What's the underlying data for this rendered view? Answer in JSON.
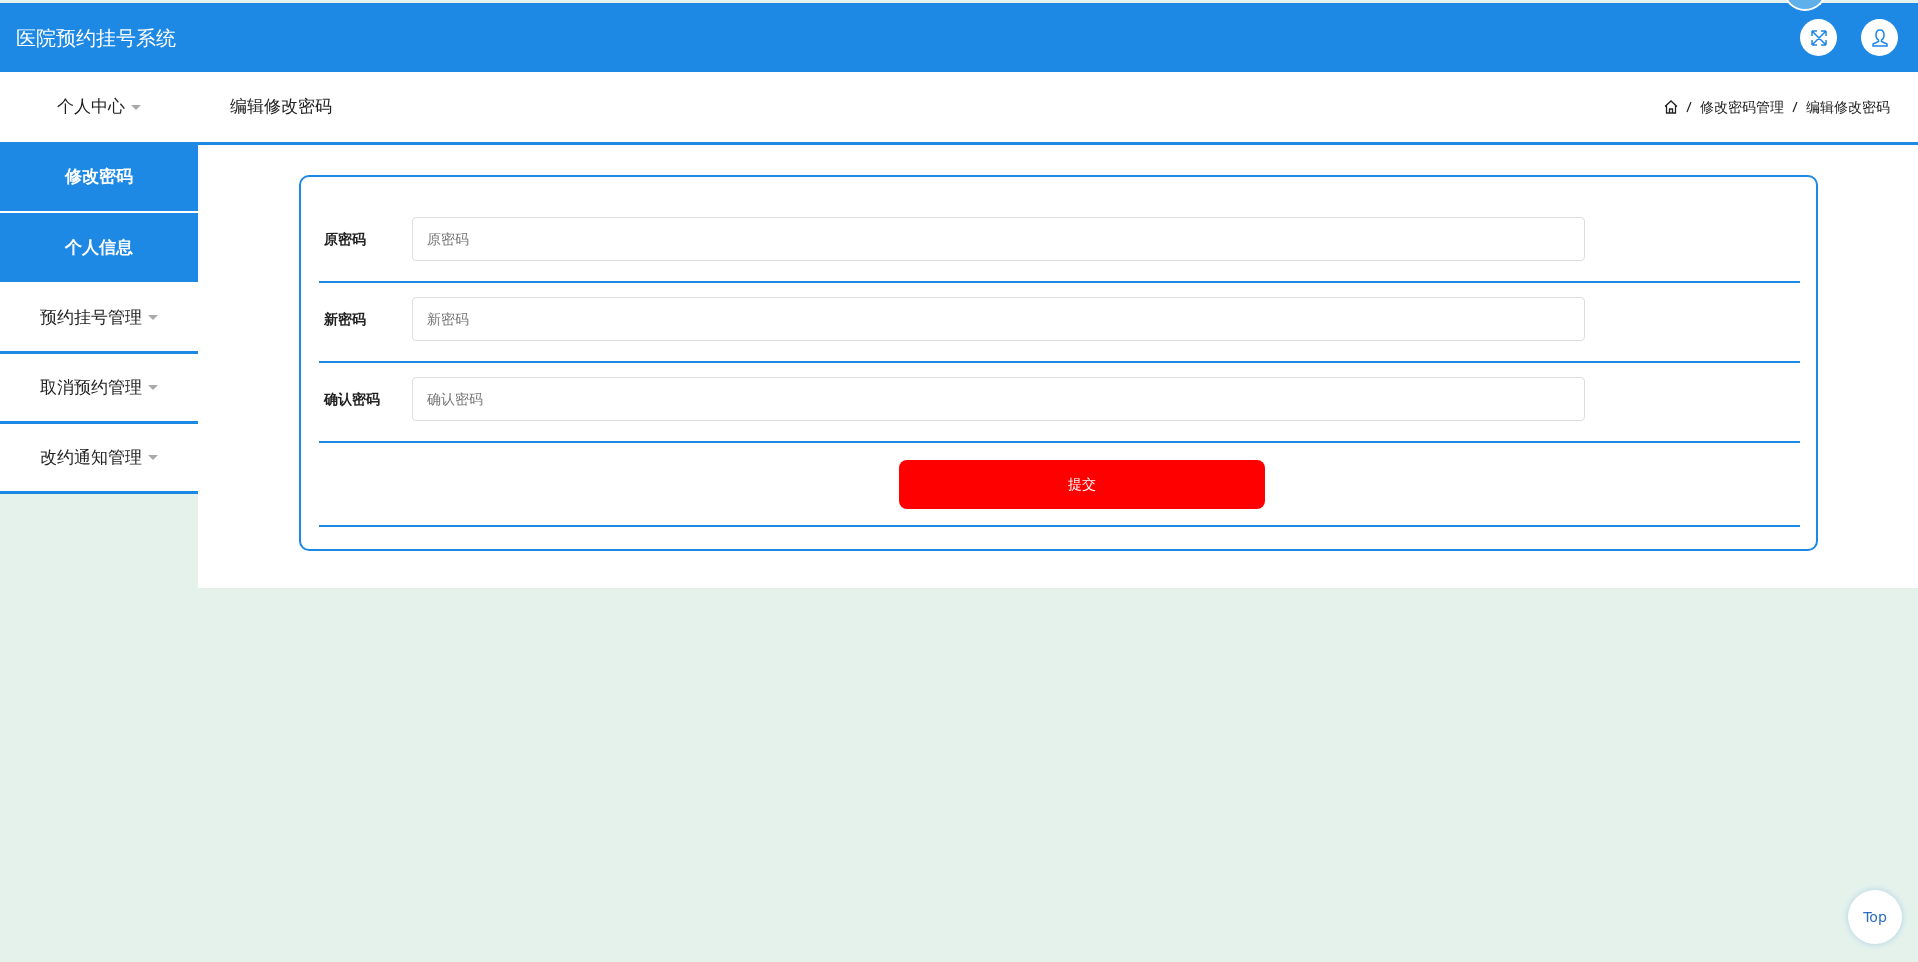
{
  "header": {
    "title": "医院预约挂号系统"
  },
  "sidebar": {
    "items": [
      {
        "label": "个人中心",
        "expanded": true,
        "children": [
          {
            "label": "修改密码"
          },
          {
            "label": "个人信息"
          }
        ]
      },
      {
        "label": "预约挂号管理",
        "expanded": false
      },
      {
        "label": "取消预约管理",
        "expanded": false
      },
      {
        "label": "改约通知管理",
        "expanded": false
      }
    ]
  },
  "page_title": "编辑修改密码",
  "breadcrumb": [
    "修改密码管理",
    "编辑修改密码"
  ],
  "form": {
    "fields": [
      {
        "label": "原密码",
        "placeholder": "原密码"
      },
      {
        "label": "新密码",
        "placeholder": "新密码"
      },
      {
        "label": "确认密码",
        "placeholder": "确认密码"
      }
    ],
    "submit": "提交"
  },
  "back_to_top": "Top"
}
